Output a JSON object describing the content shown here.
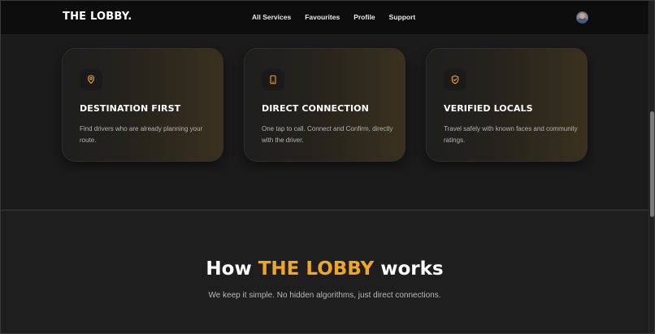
{
  "nav": {
    "logo": "THE LOBBY.",
    "links": [
      "All Services",
      "Favourites",
      "Profile",
      "Support"
    ]
  },
  "features": [
    {
      "icon": "map-pin-icon",
      "title": "DESTINATION FIRST",
      "description": "Find drivers who are already planning your route."
    },
    {
      "icon": "smartphone-icon",
      "title": "DIRECT CONNECTION",
      "description": "One tap to call. Connect and Confirm, directly with the driver."
    },
    {
      "icon": "shield-check-icon",
      "title": "VERIFIED LOCALS",
      "description": "Travel safely with known faces and community ratings."
    }
  ],
  "how": {
    "title_prefix": "How ",
    "title_accent": "THE LOBBY",
    "title_suffix": " works",
    "subtitle": "We keep it simple. No hidden algorithms, just direct connections."
  },
  "colors": {
    "accent": "#f0a525",
    "background": "#1b1b1b",
    "nav_background": "#0d0d0d"
  }
}
